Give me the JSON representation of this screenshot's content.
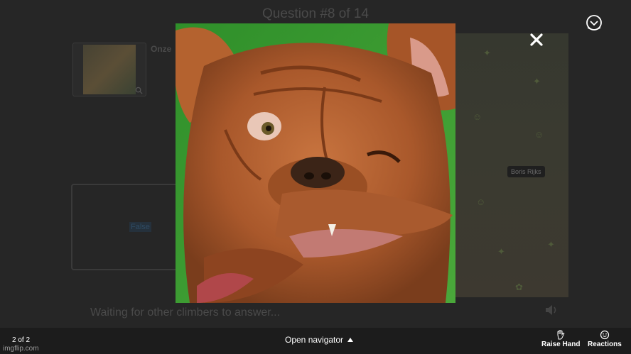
{
  "background": {
    "question_title": "Question #8 of 14",
    "thumb_caption": "Onze",
    "answer_option": "False",
    "map_user_tag": "Boris Rijks",
    "waiting_text": "Waiting for other climbers to answer..."
  },
  "lightbox": {
    "image_icon": "dog-photo",
    "close_icon": "close-icon"
  },
  "bottom_bar": {
    "page_count": "2 of 2",
    "watermark": "imgflip.com",
    "navigator_label": "Open navigator",
    "raise_hand_label": "Raise Hand",
    "reactions_label": "Reactions"
  },
  "colors": {
    "overlay_bg": "#242424",
    "bar_bg": "#1c1c1c",
    "text": "#ffffff"
  }
}
